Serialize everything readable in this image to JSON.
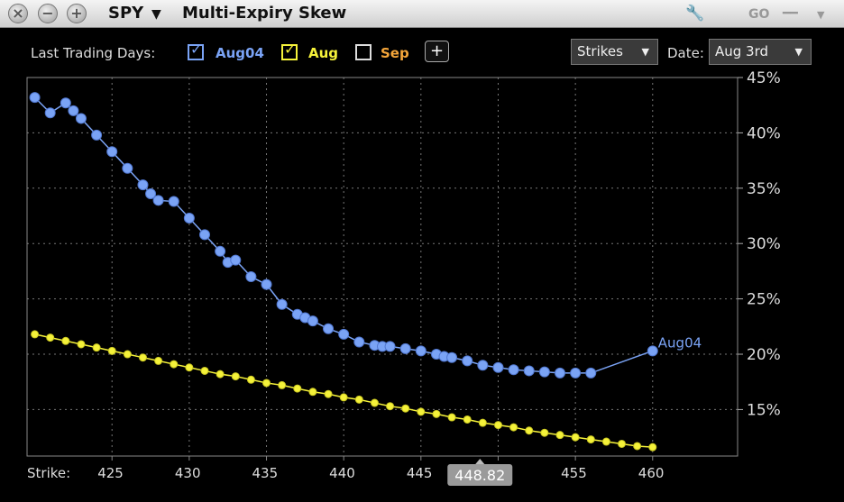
{
  "window": {
    "symbol": "SPY",
    "title": "Multi-Expiry Skew",
    "caret": "▼"
  },
  "toolbar": {
    "last_trading_days_label": "Last Trading Days:",
    "expiries": [
      {
        "label": "Aug04",
        "checked": true,
        "color": "#7aa3f5"
      },
      {
        "label": "Aug",
        "checked": true,
        "color": "#f5f23a"
      },
      {
        "label": "Sep",
        "checked": false,
        "color": "#f5a63a"
      }
    ],
    "add_label": "+",
    "mode_select": "Strikes",
    "date_label": "Date:",
    "date_select": "Aug 3rd"
  },
  "chart_data": {
    "type": "line",
    "xlabel": "Strike:",
    "x_ticks": [
      425,
      430,
      435,
      440,
      445,
      450,
      455,
      460
    ],
    "x_tick_labels": [
      "425",
      "430",
      "435",
      "440",
      "445",
      "",
      "455",
      "460"
    ],
    "xlim": [
      419.5,
      465.5
    ],
    "y_ticks": [
      15,
      20,
      25,
      30,
      35,
      40,
      45
    ],
    "y_tick_labels": [
      "15%",
      "20%",
      "25%",
      "30%",
      "35%",
      "40%",
      "45%"
    ],
    "ylim": [
      10.8,
      45.0
    ],
    "grid": true,
    "cursor_label": "448.82",
    "cursor_x": 448.82,
    "series": [
      {
        "name": "Aug04",
        "color": "#7aa3f5",
        "end_label": "Aug04",
        "x": [
          420,
          421,
          422,
          422.5,
          423,
          424,
          425,
          426,
          427,
          427.5,
          428,
          429,
          430,
          431,
          432,
          432.5,
          433,
          434,
          435,
          436,
          437,
          437.5,
          438,
          439,
          440,
          441,
          442,
          442.5,
          443,
          444,
          445,
          446,
          446.5,
          447,
          448,
          449,
          450,
          451,
          452,
          453,
          454,
          455,
          456,
          460
        ],
        "y": [
          43.2,
          41.8,
          42.7,
          42.0,
          41.3,
          39.8,
          38.3,
          36.8,
          35.3,
          34.5,
          33.9,
          33.8,
          32.3,
          30.8,
          29.3,
          28.3,
          28.5,
          27.0,
          26.3,
          24.5,
          23.6,
          23.3,
          23.0,
          22.3,
          21.8,
          21.1,
          20.8,
          20.7,
          20.7,
          20.5,
          20.3,
          20.0,
          19.8,
          19.7,
          19.4,
          19.0,
          18.8,
          18.6,
          18.5,
          18.4,
          18.3,
          18.3,
          18.3,
          20.3
        ]
      },
      {
        "name": "Aug",
        "color": "#f5f23a",
        "end_label": "",
        "x": [
          420,
          421,
          422,
          423,
          424,
          425,
          426,
          427,
          428,
          429,
          430,
          431,
          432,
          433,
          434,
          435,
          436,
          437,
          438,
          439,
          440,
          441,
          442,
          443,
          444,
          445,
          446,
          447,
          448,
          449,
          450,
          451,
          452,
          453,
          454,
          455,
          456,
          457,
          458,
          459,
          460
        ],
        "y": [
          21.8,
          21.5,
          21.2,
          20.9,
          20.6,
          20.3,
          20.0,
          19.7,
          19.4,
          19.1,
          18.8,
          18.5,
          18.2,
          18.0,
          17.7,
          17.4,
          17.2,
          16.9,
          16.6,
          16.4,
          16.1,
          15.9,
          15.6,
          15.3,
          15.1,
          14.8,
          14.6,
          14.3,
          14.1,
          13.8,
          13.6,
          13.4,
          13.1,
          12.9,
          12.7,
          12.5,
          12.3,
          12.1,
          11.9,
          11.7,
          11.6
        ]
      }
    ]
  }
}
